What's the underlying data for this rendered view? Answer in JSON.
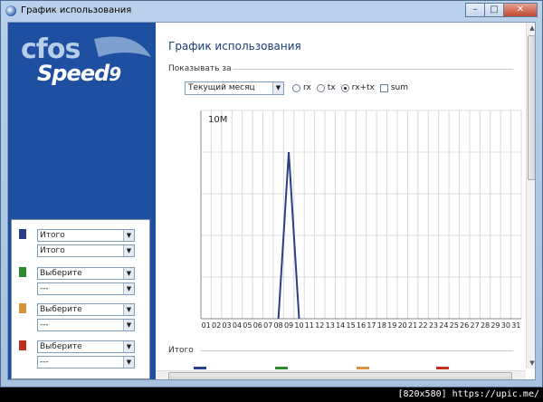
{
  "window": {
    "title": "График использования"
  },
  "left_panel": {
    "logo_top": "cfos",
    "logo_bottom": "Speed",
    "logo_num": "9",
    "groups": [
      {
        "color": "#2a3f8a",
        "primary": "Итого",
        "secondary": "Итого"
      },
      {
        "color": "#2e8a2e",
        "primary": "Выберите",
        "secondary": "---"
      },
      {
        "color": "#d8943c",
        "primary": "Выберите",
        "secondary": "---"
      },
      {
        "color": "#c03020",
        "primary": "Выберите",
        "secondary": "---"
      }
    ]
  },
  "main": {
    "page_title": "График использования",
    "show_for_label": "Показывать за",
    "range_value": "Текущий месяц",
    "options": {
      "rx": "rx",
      "tx": "tx",
      "rxtx": "rx+tx",
      "sum": "sum",
      "selected": "rxtx"
    },
    "total_label": "Итого"
  },
  "chart_data": {
    "type": "line",
    "y_top_label": "10M",
    "x_labels": [
      "01",
      "02",
      "03",
      "04",
      "05",
      "06",
      "07",
      "08",
      "09",
      "10",
      "11",
      "12",
      "13",
      "14",
      "15",
      "16",
      "17",
      "18",
      "19",
      "20",
      "21",
      "22",
      "23",
      "24",
      "25",
      "26",
      "27",
      "28",
      "29",
      "30",
      "31"
    ],
    "series": [
      {
        "color": "#2a3f8a",
        "values": [
          0,
          0,
          0,
          0,
          0,
          0,
          0,
          0,
          8,
          0,
          0,
          0,
          0,
          0,
          0,
          0,
          0,
          0,
          0,
          0,
          0,
          0,
          0,
          0,
          0,
          0,
          0,
          0,
          0,
          0,
          0
        ]
      }
    ],
    "ylim": [
      0,
      10
    ],
    "grid": true
  },
  "watermark": "[820x580] https://upic.me/"
}
